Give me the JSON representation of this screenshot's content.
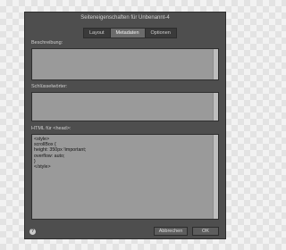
{
  "dialog": {
    "title": "Seiteneigenschaften für Unbenannt-4",
    "tabs": [
      {
        "label": "Layout"
      },
      {
        "label": "Metadaten"
      },
      {
        "label": "Optionen"
      }
    ],
    "description": {
      "label": "Beschreibung:",
      "value": ""
    },
    "keywords": {
      "label": "Schlüsselwörter:",
      "value": ""
    },
    "html_head": {
      "label": "HTML für <head>:",
      "lines": [
        "<style>",
        "scrollBox {",
        "height: 350px !important;",
        "overflow: auto;",
        "}",
        "</style>"
      ]
    },
    "buttons": {
      "cancel": "Abbrechen",
      "ok": "OK"
    },
    "help_icon": "help-icon"
  },
  "colors": {
    "dialog_bg": "#4e4e4e",
    "field_bg": "#9a9a9a",
    "active_tab": "#6b6b6b"
  }
}
